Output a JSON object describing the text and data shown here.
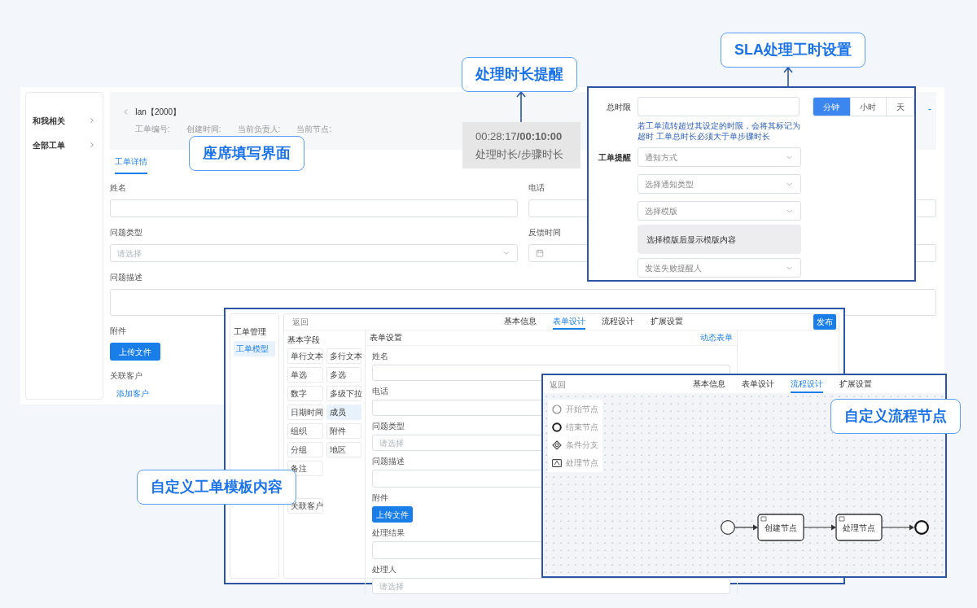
{
  "main_form": {
    "callout": "座席填写界面",
    "sidebar": [
      {
        "label": "和我相关"
      },
      {
        "label": "全部工单"
      }
    ],
    "header": {
      "title": "Ian【2000】",
      "meta": [
        "工单编号:",
        "创建时间:",
        "当前负责人:",
        "当前节点:"
      ],
      "collapse": "-"
    },
    "tabs": [
      {
        "label": "工单详情",
        "selected": true
      }
    ],
    "field_grid": [
      {
        "label": "姓名",
        "kind": "text"
      },
      {
        "label": "电话",
        "kind": "text"
      },
      {
        "label": "问题类型",
        "kind": "select",
        "placeholder": "请选择"
      },
      {
        "label": "反馈时间",
        "kind": "date"
      }
    ],
    "fields": [
      {
        "label": "问题描述",
        "kind": "textarea"
      },
      {
        "label": "附件",
        "kind": "upload",
        "button": "上传文件"
      },
      {
        "label": "关联客户",
        "kind": "link",
        "link": "添加客户"
      }
    ]
  },
  "timer": {
    "callout": "处理时长提醒",
    "value": "00:28:17**/00:10:00**",
    "caption": "处理时长/步骤时长"
  },
  "sla": {
    "callout": "SLA处理工时设置",
    "total_label": "总时限",
    "units": [
      {
        "label": "分钟",
        "selected": true
      },
      {
        "label": "小时",
        "selected": false
      },
      {
        "label": "天",
        "selected": false
      }
    ],
    "hint": "若工单流转超过其设定的时限，会将其标记为超时 工单总时长必须大于单步骤时长",
    "reminder_label": "工单提醒",
    "selects": [
      "通知方式",
      "选择通知类型",
      "选择模版"
    ],
    "preview": "选择模版后显示模版内容",
    "fail_select": "发送失败提醒人"
  },
  "template_designer": {
    "callout": "自定义工单模板内容",
    "sidebar": {
      "title": "工单管理",
      "items": [
        {
          "label": "工单模型",
          "selected": true
        }
      ]
    },
    "back": "返回",
    "tabs": [
      {
        "label": "基本信息",
        "selected": false
      },
      {
        "label": "表单设计",
        "selected": true
      },
      {
        "label": "流程设计",
        "selected": false
      },
      {
        "label": "扩展设置",
        "selected": false
      }
    ],
    "publish": "发布",
    "palette": {
      "title": "基本字段",
      "items": [
        {
          "label": "单行文本",
          "selected": false
        },
        {
          "label": "多行文本",
          "selected": false
        },
        {
          "label": "单选",
          "selected": false
        },
        {
          "label": "多选",
          "selected": false
        },
        {
          "label": "数字",
          "selected": false
        },
        {
          "label": "多级下拉",
          "selected": false
        },
        {
          "label": "日期时间",
          "selected": false
        },
        {
          "label": "成员",
          "selected": true
        },
        {
          "label": "组织",
          "selected": false
        },
        {
          "label": "附件",
          "selected": false
        },
        {
          "label": "分组",
          "selected": false
        },
        {
          "label": "地区",
          "selected": false
        },
        {
          "label": "备注",
          "selected": false
        }
      ],
      "extra": [
        {
          "label": "关联客户"
        }
      ]
    },
    "form": {
      "title": "表单设置",
      "link": "动态表单",
      "fields": [
        {
          "label": "姓名",
          "kind": "text"
        },
        {
          "label": "电话",
          "kind": "text"
        },
        {
          "label": "问题类型",
          "kind": "select",
          "placeholder": "请选择"
        },
        {
          "label": "问题描述",
          "kind": "textarea"
        },
        {
          "label": "附件",
          "kind": "upload",
          "button": "上传文件"
        },
        {
          "label": "处理结果",
          "kind": "textarea"
        },
        {
          "label": "处理人",
          "kind": "select",
          "placeholder": "请选择"
        }
      ]
    }
  },
  "flow_designer": {
    "callout": "自定义流程节点",
    "back": "返回",
    "tabs": [
      {
        "label": "基本信息",
        "selected": false
      },
      {
        "label": "表单设计",
        "selected": false
      },
      {
        "label": "流程设计",
        "selected": true
      },
      {
        "label": "扩展设置",
        "selected": false
      }
    ],
    "palette": [
      {
        "kind": "start",
        "label": "开始节点"
      },
      {
        "kind": "end",
        "label": "结束节点"
      },
      {
        "kind": "gateway",
        "label": "条件分支"
      },
      {
        "kind": "task",
        "label": "处理节点"
      }
    ],
    "nodes": [
      {
        "kind": "start"
      },
      {
        "kind": "task",
        "label": "创建节点"
      },
      {
        "kind": "task",
        "label": "处理节点"
      },
      {
        "kind": "end"
      }
    ]
  }
}
